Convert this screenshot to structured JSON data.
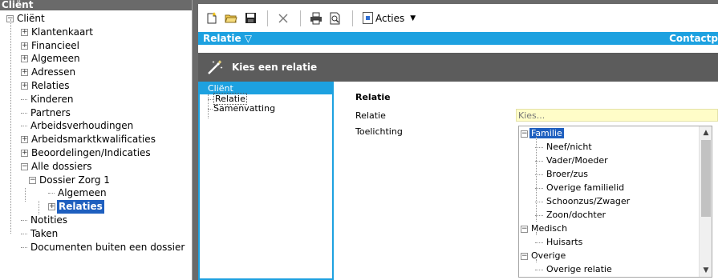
{
  "left_panel": {
    "title": "Cliënt",
    "tree": [
      {
        "label": "Cliënt",
        "expander": "−",
        "level": 0
      },
      {
        "label": "Klantenkaart",
        "expander": "+",
        "level": 1
      },
      {
        "label": "Financieel",
        "expander": "+",
        "level": 1
      },
      {
        "label": "Algemeen",
        "expander": "+",
        "level": 1
      },
      {
        "label": "Adressen",
        "expander": "+",
        "level": 1
      },
      {
        "label": "Relaties",
        "expander": "+",
        "level": 1
      },
      {
        "label": "Kinderen",
        "expander": "",
        "level": 1
      },
      {
        "label": "Partners",
        "expander": "",
        "level": 1
      },
      {
        "label": "Arbeidsverhoudingen",
        "expander": "",
        "level": 1
      },
      {
        "label": "Arbeidsmarktkwalificaties",
        "expander": "+",
        "level": 1
      },
      {
        "label": "Beoordelingen/Indicaties",
        "expander": "+",
        "level": 1
      },
      {
        "label": "Alle dossiers",
        "expander": "−",
        "level": 1
      },
      {
        "label": "Dossier Zorg 1",
        "expander": "−",
        "level": 2
      },
      {
        "label": "Algemeen",
        "expander": "",
        "level": 3
      },
      {
        "label": "Relaties",
        "expander": "+",
        "level": 3,
        "selected": true
      },
      {
        "label": "Notities",
        "expander": "",
        "level": 1
      },
      {
        "label": "Taken",
        "expander": "",
        "level": 1
      },
      {
        "label": "Documenten buiten een dossier",
        "expander": "",
        "level": 1
      }
    ]
  },
  "toolbar": {
    "new_icon": "new-document-icon",
    "open_icon": "open-folder-icon",
    "save_icon": "save-icon",
    "delete_icon": "delete-icon",
    "print_icon": "print-icon",
    "preview_icon": "print-preview-icon",
    "acties_label": "Acties",
    "acties_arrow": "▼"
  },
  "bluebar": {
    "title": "Relatie ▽",
    "right_label": "Contactp"
  },
  "wizard": {
    "title": "Kies een relatie",
    "steps_header": "Cliënt",
    "steps": [
      "Relatie",
      "Samenvatting"
    ],
    "section_title": "Relatie",
    "field_relatie_label": "Relatie",
    "field_relatie_placeholder": "Kies...",
    "field_toelichting_label": "Toelichting",
    "colors": {
      "accent": "#1da1e0",
      "header": "#5c5c5c",
      "input_bg": "#fffdc8",
      "selection": "#1e5fbf"
    }
  },
  "dropdown": {
    "items": [
      {
        "label": "Familie",
        "type": "group",
        "expander": "−",
        "highlight": true
      },
      {
        "label": "Neef/nicht",
        "type": "leaf"
      },
      {
        "label": "Vader/Moeder",
        "type": "leaf"
      },
      {
        "label": "Broer/zus",
        "type": "leaf"
      },
      {
        "label": "Overige familielid",
        "type": "leaf"
      },
      {
        "label": "Schoonzus/Zwager",
        "type": "leaf"
      },
      {
        "label": "Zoon/dochter",
        "type": "leaf"
      },
      {
        "label": "Medisch",
        "type": "group",
        "expander": "−"
      },
      {
        "label": "Huisarts",
        "type": "leaf"
      },
      {
        "label": "Overige",
        "type": "group",
        "expander": "−"
      },
      {
        "label": "Overige relatie",
        "type": "leaf"
      }
    ],
    "scroll_up": "▲",
    "scroll_down": "▼"
  }
}
